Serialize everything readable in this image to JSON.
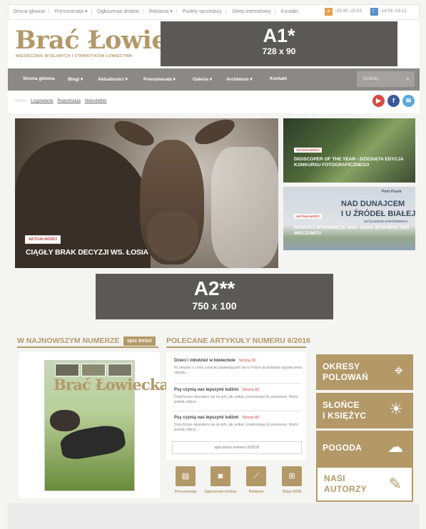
{
  "topbar": {
    "links": [
      "Strona główna",
      "Prenumerata ▾",
      "Ogłoszenia drobne",
      "Reklama ▾",
      "Punkty sprzedaży",
      "Sklep internetowy",
      "Kontakt"
    ],
    "sun_times": "↑03:30 ↓15:03",
    "moon_times": "↑14:03 ↓03:12"
  },
  "header": {
    "logo_title": "Brać Łowiecka",
    "logo_subtitle": "MIESIĘCZNIK MYŚLIWYCH I SYMPATYKÓW ŁOWIECTWA",
    "ad_a1_label": "A1*",
    "ad_a1_size": "728 x 90"
  },
  "nav": {
    "items": [
      "Strona główna",
      "Blogi ▾",
      "Aktualności ▾",
      "Prenumerata ▾",
      "Galeria ▾",
      "Archiwum ▾",
      "Kontakt"
    ],
    "search_placeholder": "Szukaj..."
  },
  "subbar": {
    "home": "Home",
    "links": [
      "Logowanie",
      "Rejestracja",
      "Newsletter"
    ]
  },
  "hero": {
    "main_tag": "AKTUALNOŚCI",
    "main_title": "CIĄGŁY BRAK DECYZJI WS. ŁOSIA",
    "side1_tag": "AKTUALNOŚCI",
    "side1_title": "DIGISCOPER OF THE YEAR - DZIESIĄTA EDYCJA KONKURSU FOTOGRAFICZNEGO",
    "side2_tag": "AKTUALNOŚCI",
    "side2_title": "NOWOŚCI WYDAWNICZE 2016 - NOWE WYDAWNICTWO MIRCZUMITU",
    "book_author": "Piotr Pusek",
    "book_title_line1": "NAD DUNAJCEM",
    "book_title_line2": "I U ŹRÓDEŁ BIAŁEJ",
    "book_subtitle": "MYŚLIWSKIE WSPOMNIENIA"
  },
  "ad_a2": {
    "label": "A2**",
    "size": "750 x 100"
  },
  "latest_issue": {
    "heading": "W NAJNOWSZYM NUMERZE",
    "toc_button": "spis treści",
    "cover_title": "Brać Łowiecka"
  },
  "recommended": {
    "heading": "POLECANE ARTYKUŁY NUMERU 6/2016",
    "articles": [
      {
        "title": "Dzieci i młodzież w łowiectwie",
        "page": "Strona 30",
        "desc": "W związku z coraz częściej pojawiającymi się w Polsce postulatami ograniczenia udziału..."
      },
      {
        "title": "Psy czynią nas lepszymi ludźmi",
        "page": "Strona 82",
        "desc": "Dotychczas słuszałem się na tym, jak unikać czworonoga do polowania. Warto jednak odkryć..."
      },
      {
        "title": "Psy czynią nas lepszymi ludźmi",
        "page": "Strona 82",
        "desc": "Dotychczas słuszałem się na tym, jak unikać czworonoga do polowania. Warto jednak odkryć..."
      }
    ],
    "toc_link": "spis treści numeru 6/2015"
  },
  "quick_links": [
    {
      "label": "Prenumerata",
      "icon": "newspaper-icon",
      "glyph": "▤"
    },
    {
      "label": "Ogłoszenia drobne",
      "icon": "chat-icon",
      "glyph": "◙"
    },
    {
      "label": "Reklama",
      "icon": "chart-icon",
      "glyph": "⟋"
    },
    {
      "label": "Sklep KDW",
      "icon": "cart-icon",
      "glyph": "⊞"
    }
  ],
  "tiles": [
    {
      "line1": "OKRESY",
      "line2": "POLOWAŃ",
      "icon": "crosshair-icon",
      "glyph": "⌖"
    },
    {
      "line1": "SŁOŃCE",
      "line2": "I KSIĘŻYC",
      "icon": "sun-moon-icon",
      "glyph": "☀"
    },
    {
      "line1": "POGODA",
      "line2": "",
      "icon": "weather-icon",
      "glyph": "☁"
    },
    {
      "line1": "NASI",
      "line2": "AUTORZY",
      "icon": "pencil-icon",
      "glyph": "✎"
    }
  ],
  "colors": {
    "brand_gold": "#b39968",
    "nav_grey": "#8a8988",
    "ad_grey": "#5a5958",
    "tag_red": "#c9423c",
    "youtube": "#d64a43",
    "facebook": "#3b5a9a",
    "mail": "#5ba8d8"
  }
}
